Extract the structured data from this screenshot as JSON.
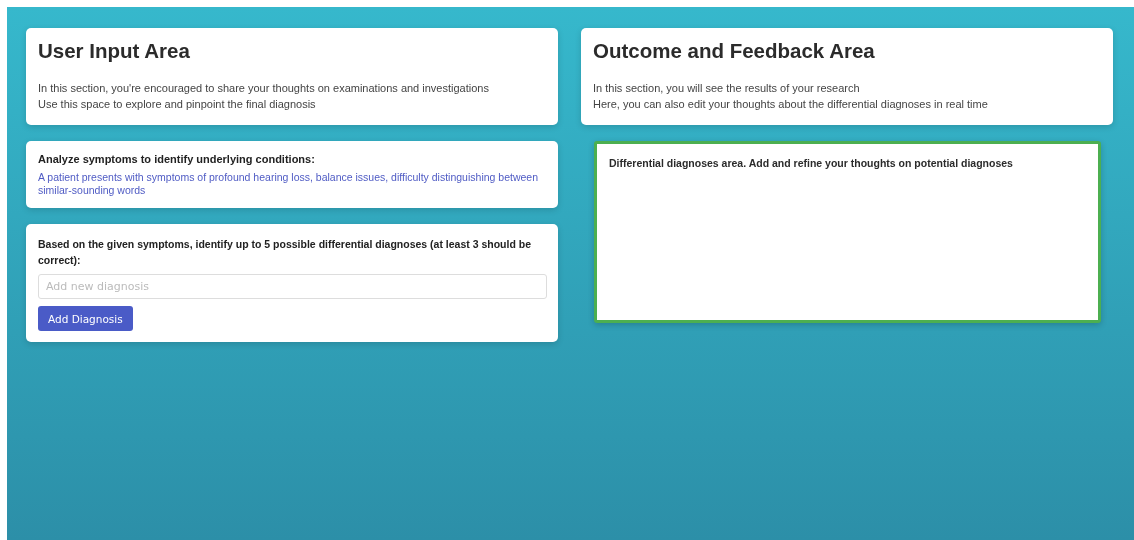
{
  "user_input": {
    "title": "User Input Area",
    "lines": [
      "In this section, you're encouraged to share your thoughts on examinations and investigations",
      "Use this space to explore and pinpoint the final diagnosis"
    ]
  },
  "symptoms": {
    "heading": "Analyze symptoms to identify underlying conditions:",
    "description": "A patient presents with symptoms of profound hearing loss, balance issues, difficulty distinguishing between similar-sounding words"
  },
  "diagnosis_form": {
    "prompt": "Based on the given symptoms, identify up to 5 possible differential diagnoses (at least 3 should be correct):",
    "placeholder": "Add new diagnosis",
    "button": "Add Diagnosis"
  },
  "outcome": {
    "title": "Outcome and Feedback Area",
    "lines": [
      "In this section, you will see the results of your research",
      "Here, you can also edit your thoughts about the differential diagnoses in real time"
    ]
  },
  "differential_area": {
    "heading": "Differential diagnoses area. Add and refine your thoughts on potential diagnoses"
  }
}
